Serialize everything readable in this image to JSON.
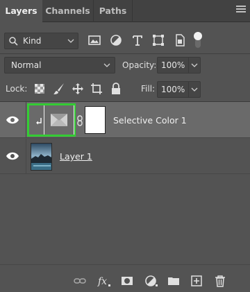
{
  "tabs": [
    {
      "label": "Layers",
      "active": true
    },
    {
      "label": "Channels",
      "active": false
    },
    {
      "label": "Paths",
      "active": false
    }
  ],
  "filter": {
    "kind_label": "Kind",
    "icons": [
      "image-filter-icon",
      "adjustment-filter-icon",
      "type-filter-icon",
      "shape-filter-icon",
      "smart-object-filter-icon"
    ]
  },
  "blend": {
    "mode": "Normal",
    "opacity_label": "Opacity:",
    "opacity_value": "100%"
  },
  "lock": {
    "label": "Lock:",
    "fill_label": "Fill:",
    "fill_value": "100%"
  },
  "layers": [
    {
      "name": "Selective Color 1",
      "type": "adjustment",
      "selected": true,
      "visible": true,
      "clipped": true
    },
    {
      "name": "Layer 1",
      "type": "pixel",
      "selected": false,
      "visible": true
    }
  ],
  "footer_icons": [
    "link-layers-icon",
    "fx-icon",
    "add-mask-icon",
    "new-adjustment-icon",
    "new-group-icon",
    "new-layer-icon",
    "delete-icon"
  ],
  "colors": {
    "panel": "#535353",
    "selected_row": "#6a6a6a",
    "highlight": "#33cc33"
  }
}
